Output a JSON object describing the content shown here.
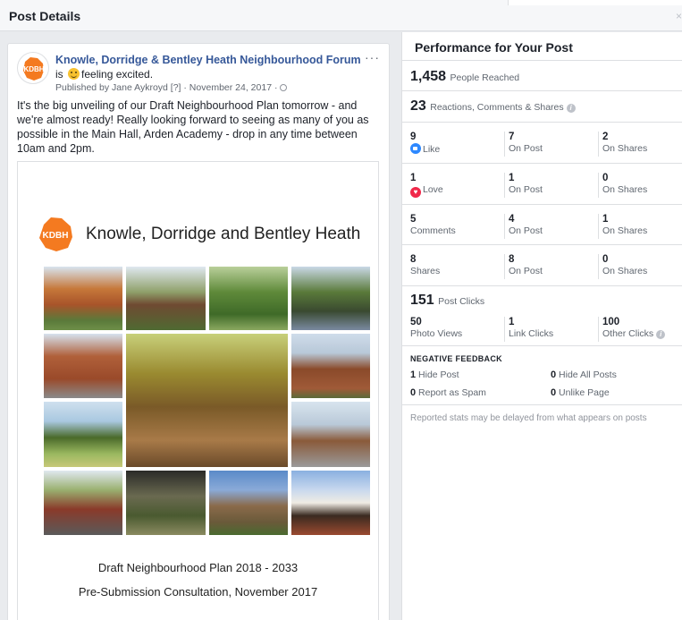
{
  "window": {
    "title": "Post Details",
    "close_symbol": "×"
  },
  "post": {
    "page_name": "Knowle, Dorridge & Bentley Heath Neighbourhood Forum",
    "avatar_text": "KDBH",
    "feeling_prefix": "is",
    "feeling_text": "feeling excited.",
    "published": "Published by Jane Aykroyd [?] · November 24, 2017 · ",
    "more_symbol": "···",
    "body": "It's the big unveiling of our Draft Neighbourhood Plan tomorrow - and we're almost ready! Really looking forward to seeing as many of you as possible in the Main Hall, Arden Academy - drop in any time between 10am and 2pm.",
    "document": {
      "logo_text": "KDBH",
      "title": "Knowle, Dorridge and Bentley Heath",
      "caption1": "Draft Neighbourhood Plan 2018 - 2033",
      "caption2": "Pre-Submission Consultation, November 2017"
    }
  },
  "performance": {
    "title": "Performance for Your Post",
    "reached_num": "1,458",
    "reached_label": "People Reached",
    "engagement_num": "23",
    "engagement_label": "Reactions, Comments & Shares",
    "rows": [
      {
        "total": "9",
        "total_label": "Like",
        "post": "7",
        "post_label": "On Post",
        "shares": "2",
        "shares_label": "On Shares"
      },
      {
        "total": "1",
        "total_label": "Love",
        "post": "1",
        "post_label": "On Post",
        "shares": "0",
        "shares_label": "On Shares"
      },
      {
        "total": "5",
        "total_label": "Comments",
        "post": "4",
        "post_label": "On Post",
        "shares": "1",
        "shares_label": "On Shares"
      },
      {
        "total": "8",
        "total_label": "Shares",
        "post": "8",
        "post_label": "On Post",
        "shares": "0",
        "shares_label": "On Shares"
      }
    ],
    "clicks_num": "151",
    "clicks_label": "Post Clicks",
    "clicks": {
      "photo_num": "50",
      "photo_label": "Photo Views",
      "link_num": "1",
      "link_label": "Link Clicks",
      "other_num": "100",
      "other_label": "Other Clicks"
    },
    "negative": {
      "title": "NEGATIVE FEEDBACK",
      "hide_post_num": "1",
      "hide_post_label": "Hide Post",
      "hide_all_num": "0",
      "hide_all_label": "Hide All Posts",
      "spam_num": "0",
      "spam_label": "Report as Spam",
      "unlike_num": "0",
      "unlike_label": "Unlike Page"
    },
    "note": "Reported stats may be delayed from what appears on posts",
    "info_symbol": "i"
  },
  "colors": {
    "brand_blue": "#365899",
    "like_blue": "#2d88ff",
    "love_red": "#f0284a",
    "kdbh_orange": "#f47a20"
  }
}
